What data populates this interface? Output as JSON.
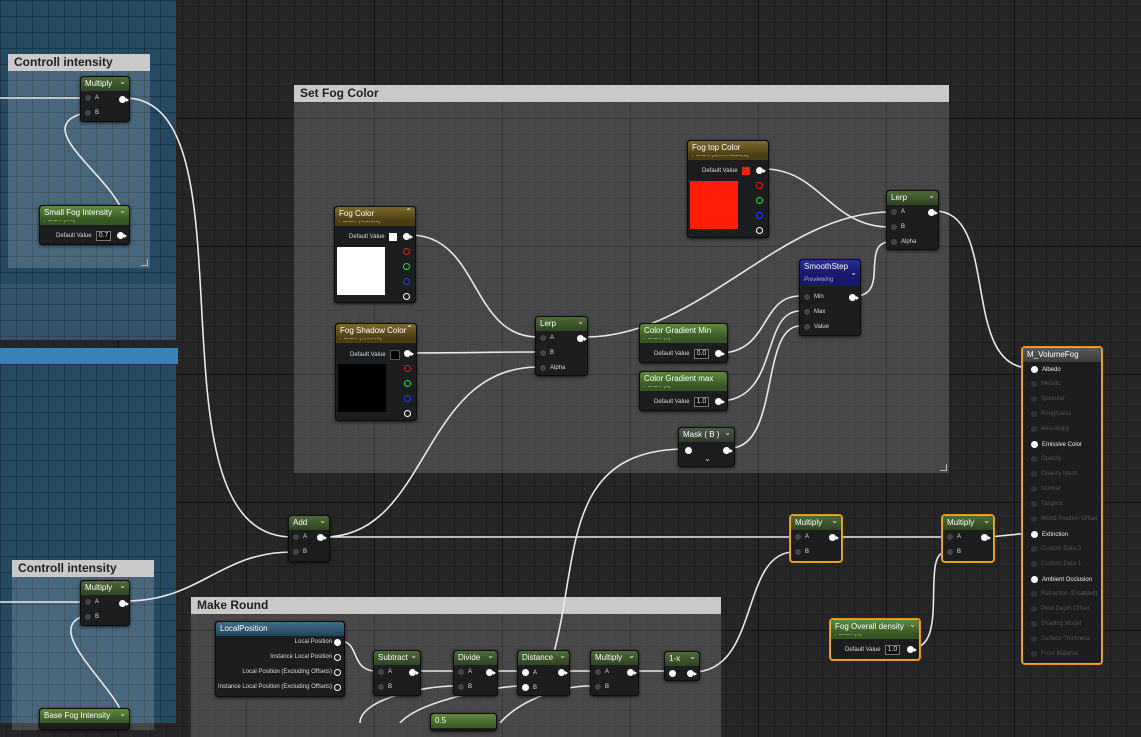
{
  "comments": {
    "controll1": "Controll intensity",
    "controll2": "Controll intensity",
    "fogcolor": "Set Fog Color",
    "makeround": "Make Round"
  },
  "nodes": {
    "multiply_a": "Multiply",
    "multiply_b": "Multiply",
    "small_fog": {
      "title": "Small Fog Intensity",
      "sub": "Param (0.0)",
      "label": "Default Value",
      "value": "0.7"
    },
    "base_fog": {
      "title": "Base Fog Intensity"
    },
    "fog_color": {
      "title": "Fog Color",
      "sub": "Param (1,1,1,1)",
      "label": "Default Value",
      "swatch": "#ffffff"
    },
    "fog_shadow": {
      "title": "Fog Shadow Color",
      "sub": "Param (0,0,0,1)",
      "label": "Default Value",
      "swatch": "#000000"
    },
    "fog_top": {
      "title": "Fog top Color",
      "sub": "Param (1,0,0.0353,1)",
      "label": "Default Value",
      "swatch": "#ff1e0a"
    },
    "lerp_mid": "Lerp",
    "lerp_top": "Lerp",
    "grad_min": {
      "title": "Color Gradient Min",
      "sub": "Param (0)",
      "label": "Default Value",
      "value": "0.0"
    },
    "grad_max": {
      "title": "Color Gradient max",
      "sub": "Param (1)",
      "label": "Default Value",
      "value": "1.0"
    },
    "smoothstep": {
      "title": "SmoothStep",
      "sub": "Previewing"
    },
    "mask": "Mask ( B )",
    "add": "Add",
    "multiply_c": "Multiply",
    "multiply_d": "Multiply",
    "fog_overall": {
      "title": "Fog Overall density",
      "sub": "Param (1)",
      "label": "Default Value",
      "value": "1.0"
    },
    "local_position": "LocalPosition",
    "subtract": "Subtract",
    "divide": "Divide",
    "distance": "Distance",
    "multiply_e": "Multiply",
    "one_minus": "1-x",
    "const_half": "0.5"
  },
  "pins": {
    "a": "A",
    "b": "B",
    "alpha": "Alpha",
    "min": "Min",
    "max": "Max",
    "value": "Value",
    "local_position": "Local Position",
    "instance_local_position": "Instance Local Position",
    "local_position_excl": "Local Position (Excluding Offsets)",
    "instance_local_position_excl": "Instance Local Position (Excluding Offsets)"
  },
  "material": {
    "title": "M_VolumeFog",
    "pins": [
      {
        "label": "Albedo",
        "on": true
      },
      {
        "label": "Metallic",
        "on": false
      },
      {
        "label": "Specular",
        "on": false
      },
      {
        "label": "Roughness",
        "on": false
      },
      {
        "label": "Anisotropy",
        "on": false
      },
      {
        "label": "Emissive Color",
        "on": true
      },
      {
        "label": "Opacity",
        "on": false
      },
      {
        "label": "Opacity Mask",
        "on": false
      },
      {
        "label": "Normal",
        "on": false
      },
      {
        "label": "Tangent",
        "on": false
      },
      {
        "label": "World Position Offset",
        "on": false
      },
      {
        "label": "Extinction",
        "on": true
      },
      {
        "label": "Custom Data 0",
        "on": false
      },
      {
        "label": "Custom Data 1",
        "on": false
      },
      {
        "label": "Ambient Occlusion",
        "on": true
      },
      {
        "label": "Refraction (Disabled)",
        "on": false
      },
      {
        "label": "Pixel Depth Offset",
        "on": false
      },
      {
        "label": "Shading Model",
        "on": false
      },
      {
        "label": "Surface Thickness",
        "on": false
      },
      {
        "label": "Front Material",
        "on": false
      }
    ]
  }
}
